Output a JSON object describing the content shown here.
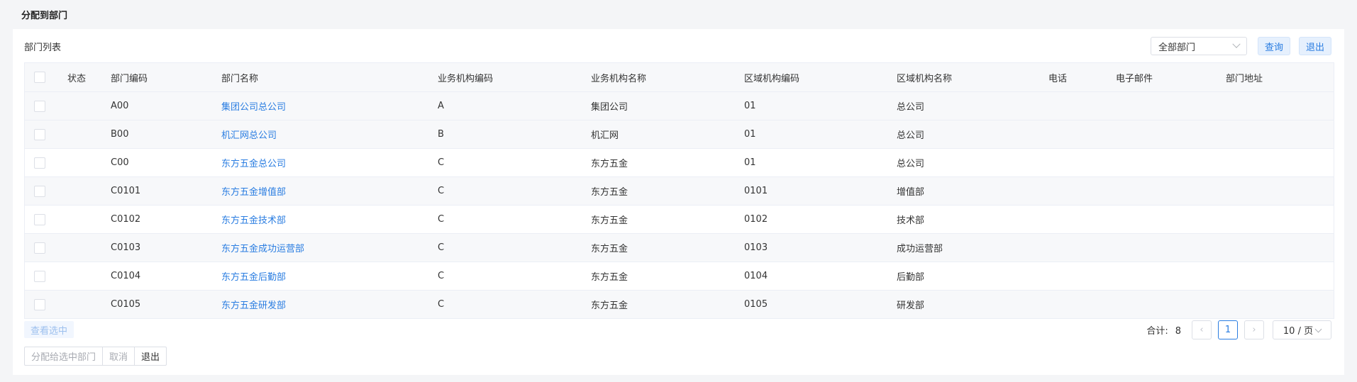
{
  "page": {
    "title": "分配到部门"
  },
  "list": {
    "title": "部门列表",
    "filter_value": "全部部门",
    "query_label": "查询",
    "exit_label": "退出"
  },
  "table": {
    "headers": {
      "status": "状态",
      "code": "部门编码",
      "name": "部门名称",
      "biz_code": "业务机构编码",
      "biz_name": "业务机构名称",
      "area_code": "区域机构编码",
      "area_name": "区域机构名称",
      "phone": "电话",
      "email": "电子邮件",
      "address": "部门地址"
    },
    "rows": [
      {
        "status": "",
        "code": "A00",
        "name": "集团公司总公司",
        "biz_code": "A",
        "biz_name": "集团公司",
        "area_code": "01",
        "area_name": "总公司",
        "phone": "",
        "email": "",
        "address": ""
      },
      {
        "status": "",
        "code": "B00",
        "name": "机汇网总公司",
        "biz_code": "B",
        "biz_name": "机汇网",
        "area_code": "01",
        "area_name": "总公司",
        "phone": "",
        "email": "",
        "address": ""
      },
      {
        "status": "",
        "code": "C00",
        "name": "东方五金总公司",
        "biz_code": "C",
        "biz_name": "东方五金",
        "area_code": "01",
        "area_name": "总公司",
        "phone": "",
        "email": "",
        "address": ""
      },
      {
        "status": "",
        "code": "C0101",
        "name": "东方五金增值部",
        "biz_code": "C",
        "biz_name": "东方五金",
        "area_code": "0101",
        "area_name": "增值部",
        "phone": "",
        "email": "",
        "address": ""
      },
      {
        "status": "",
        "code": "C0102",
        "name": "东方五金技术部",
        "biz_code": "C",
        "biz_name": "东方五金",
        "area_code": "0102",
        "area_name": "技术部",
        "phone": "",
        "email": "",
        "address": ""
      },
      {
        "status": "",
        "code": "C0103",
        "name": "东方五金成功运营部",
        "biz_code": "C",
        "biz_name": "东方五金",
        "area_code": "0103",
        "area_name": "成功运营部",
        "phone": "",
        "email": "",
        "address": ""
      },
      {
        "status": "",
        "code": "C0104",
        "name": "东方五金后勤部",
        "biz_code": "C",
        "biz_name": "东方五金",
        "area_code": "0104",
        "area_name": "后勤部",
        "phone": "",
        "email": "",
        "address": ""
      },
      {
        "status": "",
        "code": "C0105",
        "name": "东方五金研发部",
        "biz_code": "C",
        "biz_name": "东方五金",
        "area_code": "0105",
        "area_name": "研发部",
        "phone": "",
        "email": "",
        "address": ""
      }
    ]
  },
  "footer": {
    "view_selected": "查看选中",
    "assign_label": "分配给选中部门",
    "cancel_label": "取消",
    "exit_label": "退出"
  },
  "pagination": {
    "total_label": "合计:",
    "total": "8",
    "prev_icon": "‹",
    "current_page": "1",
    "next_icon": "›",
    "page_size": "10 / 页"
  },
  "colors": {
    "accent": "#2a7de1",
    "stripe": "#f7f8fa"
  }
}
